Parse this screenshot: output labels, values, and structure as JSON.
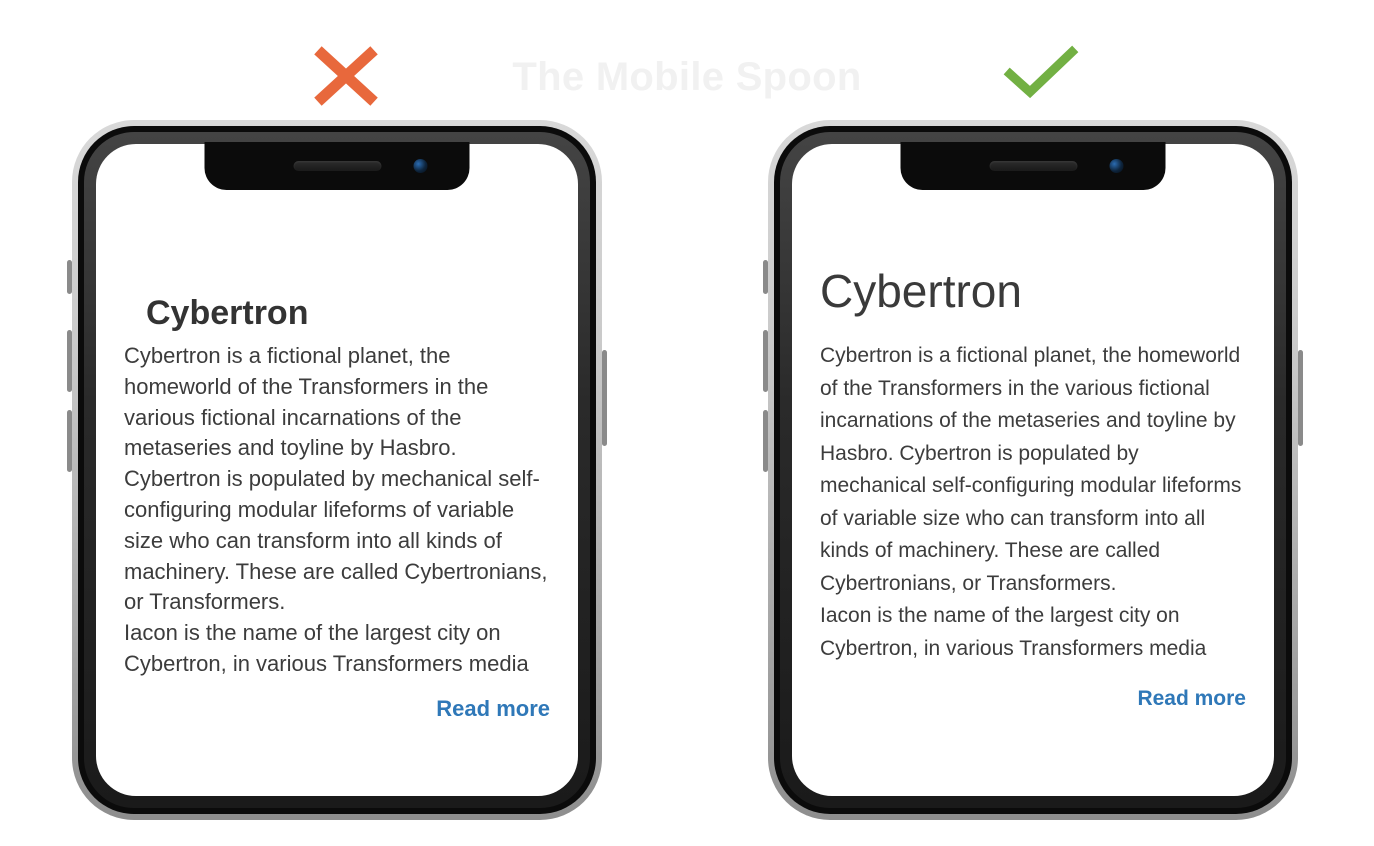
{
  "watermark": "The Mobile Spoon",
  "panels": {
    "bad": {
      "mark": "cross",
      "title": "Cybertron",
      "body": "Cybertron is a fictional planet, the homeworld of the Transformers in the various fictional incarnations of the metaseries and toyline by Hasbro. Cybertron is populated by mechanical self-configuring modular lifeforms of variable size who can transform into all kinds of machinery. These are called Cybertronians, or Transformers.\nIacon is the name of the largest city on Cybertron, in various Transformers media",
      "read_more": "Read more"
    },
    "good": {
      "mark": "check",
      "title": "Cybertron",
      "body": "Cybertron is a fictional planet, the homeworld of the Transformers in the various fictional incarnations of the metaseries and toyline by Hasbro. Cybertron is populated by mechanical self-configuring modular lifeforms of variable size who can transform into all kinds of machinery. These are called Cybertronians, or Transformers.\nIacon is the name of the largest city on Cybertron, in various Transformers media",
      "read_more": "Read more"
    }
  },
  "colors": {
    "cross": "#e8683c",
    "check": "#72b043",
    "link": "#2f78b8"
  }
}
